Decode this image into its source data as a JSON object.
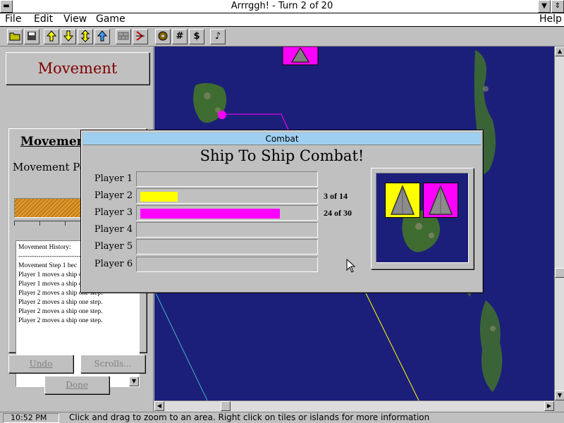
{
  "window": {
    "title": "Arrrggh!  -  Turn 2 of 20"
  },
  "menu": {
    "file": "File",
    "edit": "Edit",
    "view": "View",
    "game": "Game",
    "help": "Help"
  },
  "toolbar": {
    "icons": [
      "open-folder-icon",
      "save-disk-icon",
      "arrow-up-icon",
      "arrow-down-icon",
      "arrow-up-down-icon",
      "arrow-up-next-icon",
      "wall-icon",
      "direction-icon",
      "compass-wheel-icon",
      "grid-icon",
      "money-icon",
      "music-note-icon"
    ],
    "grid_glyph": "#",
    "money_glyph": "$",
    "music_glyph": "♪"
  },
  "left_panel": {
    "header": "Movement",
    "section_title": "Movement",
    "points_label": "Movement Po",
    "history": {
      "title": "Movement History:",
      "separator": "------------------------------------------",
      "lines": [
        "Movement Step 1 bec",
        "Player 1 moves a ship one step.",
        "Player 1 moves a ship one step.",
        "Player 2 moves a ship one step.",
        "Player 2 moves a ship one step.",
        "Player 2 moves a ship one step.",
        "Player 2 moves a ship one step."
      ]
    },
    "buttons": {
      "undo": "Undo",
      "scrolls": "Scrolls...",
      "done": "Done"
    }
  },
  "dialog": {
    "title": "Combat",
    "heading": "Ship To Ship Combat!",
    "players": [
      {
        "label": "Player 1",
        "value_text": "",
        "fill_fraction": 0,
        "color": ""
      },
      {
        "label": "Player 2",
        "value_text": "3 of 14",
        "fill_fraction": 0.214,
        "color": "#ffff00"
      },
      {
        "label": "Player 3",
        "value_text": "24 of 30",
        "fill_fraction": 0.8,
        "color": "#ff00ff"
      },
      {
        "label": "Player 4",
        "value_text": "",
        "fill_fraction": 0,
        "color": ""
      },
      {
        "label": "Player 5",
        "value_text": "",
        "fill_fraction": 0,
        "color": ""
      },
      {
        "label": "Player 6",
        "value_text": "",
        "fill_fraction": 0,
        "color": ""
      }
    ],
    "ships": [
      {
        "icon": "ship-triangle-icon",
        "color": "#ffff00"
      },
      {
        "icon": "ship-triangle-icon",
        "color": "#ff00ff"
      }
    ]
  },
  "status": {
    "time": "10:52 PM",
    "message": "Click and drag to zoom to an area.  Right click on tiles or islands for more information"
  },
  "colors": {
    "sea": "#1c1f7a",
    "player2": "#ffff00",
    "player3": "#ff00ff",
    "header_text": "#800000",
    "dialog_title": "#9ecff0"
  }
}
